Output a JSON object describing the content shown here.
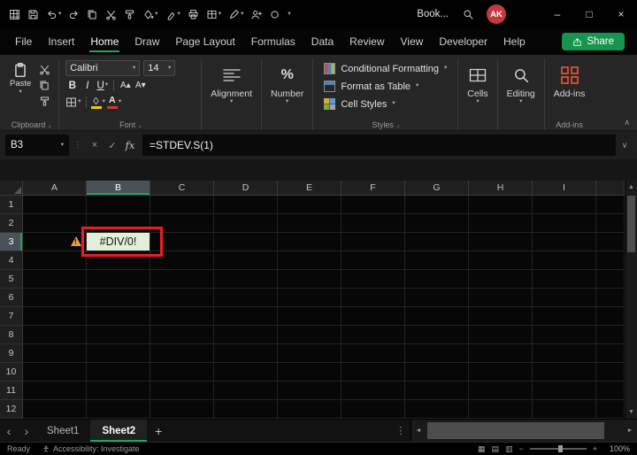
{
  "titlebar": {
    "document_name": "Book...",
    "avatar_initials": "AK"
  },
  "menubar": {
    "items": [
      "File",
      "Insert",
      "Home",
      "Draw",
      "Page Layout",
      "Formulas",
      "Data",
      "Review",
      "View",
      "Developer",
      "Help"
    ],
    "active_item": "Home",
    "share_label": "Share"
  },
  "ribbon": {
    "clipboard": {
      "paste_label": "Paste",
      "group_label": "Clipboard"
    },
    "font": {
      "family": "Calibri",
      "size": "14",
      "group_label": "Font"
    },
    "alignment_label": "Alignment",
    "number_label": "Number",
    "styles": {
      "conditional_formatting": "Conditional Formatting",
      "format_as_table": "Format as Table",
      "cell_styles": "Cell Styles",
      "group_label": "Styles"
    },
    "cells_label": "Cells",
    "editing_label": "Editing",
    "addins_label": "Add-ins",
    "addins_group_label": "Add-ins"
  },
  "formula_bar": {
    "name_box": "B3",
    "formula": "=STDEV.S(1)"
  },
  "grid": {
    "columns": [
      "A",
      "B",
      "C",
      "D",
      "E",
      "F",
      "G",
      "H",
      "I"
    ],
    "rows": [
      "1",
      "2",
      "3",
      "4",
      "5",
      "6",
      "7",
      "8",
      "9",
      "10",
      "11",
      "12"
    ],
    "selected_column": "B",
    "selected_row": "3",
    "warning_cell_ref": "A3",
    "error_cell": {
      "ref": "B3",
      "value": "#DIV/0!",
      "fill_color": "#e2efda",
      "highlight_border_color": "#ed1c24"
    }
  },
  "sheet_tabs": {
    "tabs": [
      "Sheet1",
      "Sheet2"
    ],
    "active_tab": "Sheet2"
  },
  "status_bar": {
    "mode": "Ready",
    "accessibility": "Accessibility: Investigate",
    "zoom_level": "100%"
  },
  "colors": {
    "accent_green": "#21a366",
    "share_button_green": "#17944e",
    "avatar_red": "#c43a3a",
    "addins_orange": "#e0502f",
    "error_cell_fill": "#e2efda",
    "highlight_red": "#ed1c24",
    "warning_orange": "#e9a23b"
  },
  "icons": {
    "caret_down": "▾",
    "chevron_up": "∧",
    "chevron_down": "∨",
    "dialog_launcher": "⌟",
    "vertical_dots": "⋮",
    "minimize": "–",
    "maximize": "□",
    "close": "×",
    "cancel": "×",
    "enter": "✓",
    "fx": "fx",
    "percent": "%",
    "bold": "B",
    "italic": "I",
    "underline": "U",
    "grow_font": "A▴",
    "shrink_font": "A▾",
    "font_color_letter": "A",
    "fill_color_letter": "A",
    "tab_prev": "‹",
    "tab_next": "›",
    "scroll_left": "◄",
    "scroll_right": "►",
    "scroll_up": "▲",
    "scroll_down": "▼",
    "add_sheet": "+",
    "zoom_out": "−",
    "zoom_in": "+",
    "view_normal": "▦",
    "view_layout": "▤",
    "view_break": "▥"
  }
}
